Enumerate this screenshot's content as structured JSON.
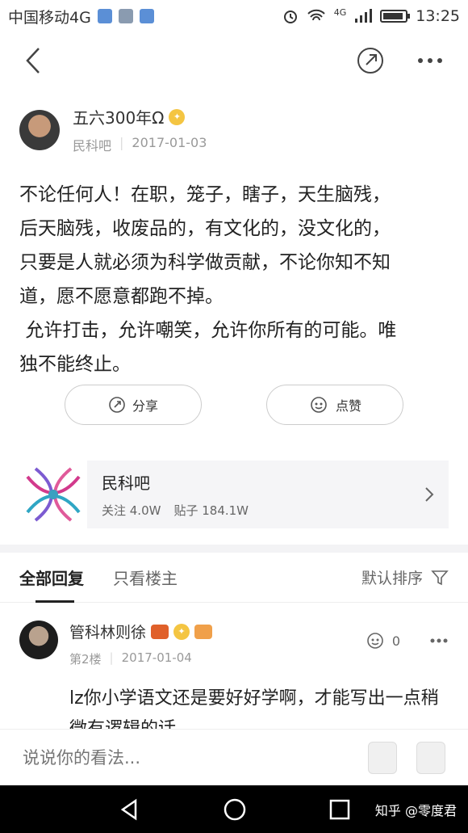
{
  "status_bar": {
    "carrier": "中国移动4G",
    "network": "4G",
    "time": "13:25"
  },
  "nav": {
    "back_icon": "chevron-left-icon",
    "share_icon": "share-icon",
    "more_icon": "more-icon"
  },
  "author": {
    "name": "五六300年Ω",
    "forum": "民科吧",
    "date": "2017-01-03"
  },
  "post": {
    "body": "不论任何人！在职，笼子，瞎子，天生脑残，\n后天脑残，收废品的，有文化的，没文化的，\n只要是人就必须为科学做贡献，不论你知不知\n道，愿不愿意都跑不掉。\n 允许打击，允许嘲笑，允许你所有的可能。唯\n独不能终止。"
  },
  "actions": {
    "share_label": "分享",
    "like_label": "点赞"
  },
  "forum_card": {
    "name": "民科吧",
    "followers": "关注 4.0W",
    "posts": "贴子 184.1W"
  },
  "tabs": {
    "all_replies": "全部回复",
    "op_only": "只看楼主",
    "sort_label": "默认排序"
  },
  "reply": {
    "name": "管科林则徐",
    "floor": "第2楼",
    "date": "2017-01-04",
    "like_count": "0",
    "text": "lz你小学语文还是要好好学啊，才能写出一点稍微有逻辑的话。"
  },
  "comment_bar": {
    "placeholder": "说说你的看法..."
  },
  "watermark": "知乎 @零度君",
  "colors": {
    "gold_badge": "#f4c542",
    "card_bg": "#f5f5f7",
    "text_dark": "#222222",
    "text_muted": "#999999"
  }
}
